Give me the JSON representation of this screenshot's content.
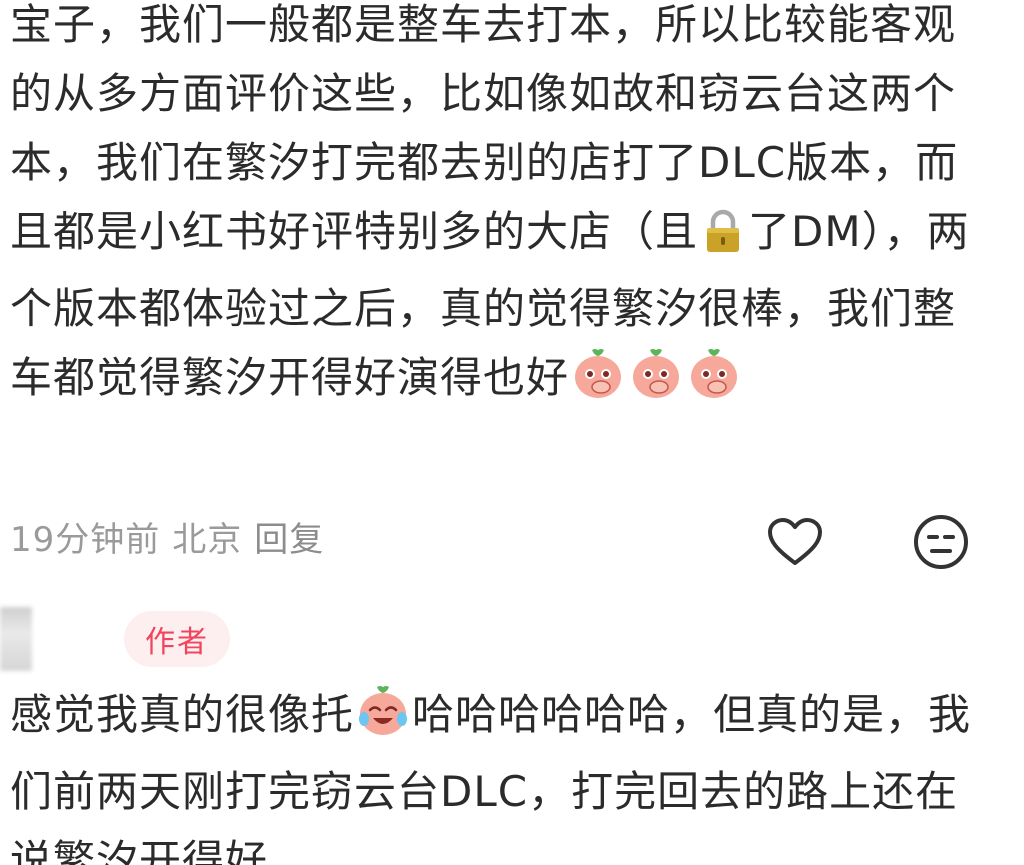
{
  "comment1": {
    "segments": [
      "宝子，我们一般都是整车去打本，所以比较能客观的从多方面评价这些，比如像如故和窃云台这两个本，我们在繁汐打完都去别的店打了DLC版本，而且都是小红书好评特别多的大店（且",
      "了DM），两个版本都体验过之后，真的觉得繁汐很棒，我们整车都觉得繁汐开得好演得也好"
    ],
    "lock_icon": "lock-icon",
    "emojis": [
      "covering-mouth-peach-emoji",
      "covering-mouth-peach-emoji",
      "covering-mouth-peach-emoji"
    ]
  },
  "meta": {
    "time": "19分钟前",
    "location": "北京",
    "reply": "回复"
  },
  "actions": {
    "like_icon": "heart-outline-icon",
    "dislike_icon": "meh-face-icon"
  },
  "comment2": {
    "badge": "作者",
    "text_before": "感觉我真的很像托",
    "emoji": "crying-laughing-peach-emoji",
    "text_after": "哈哈哈哈哈哈，但真的是，我们前两天刚打完窃云台DLC，打完回去的路上还在说繁汐开得好"
  },
  "colors": {
    "text": "#2b2b2b",
    "meta": "#9a9a9a",
    "badge_text": "#f0455c",
    "badge_bg": "#fdeef0"
  }
}
